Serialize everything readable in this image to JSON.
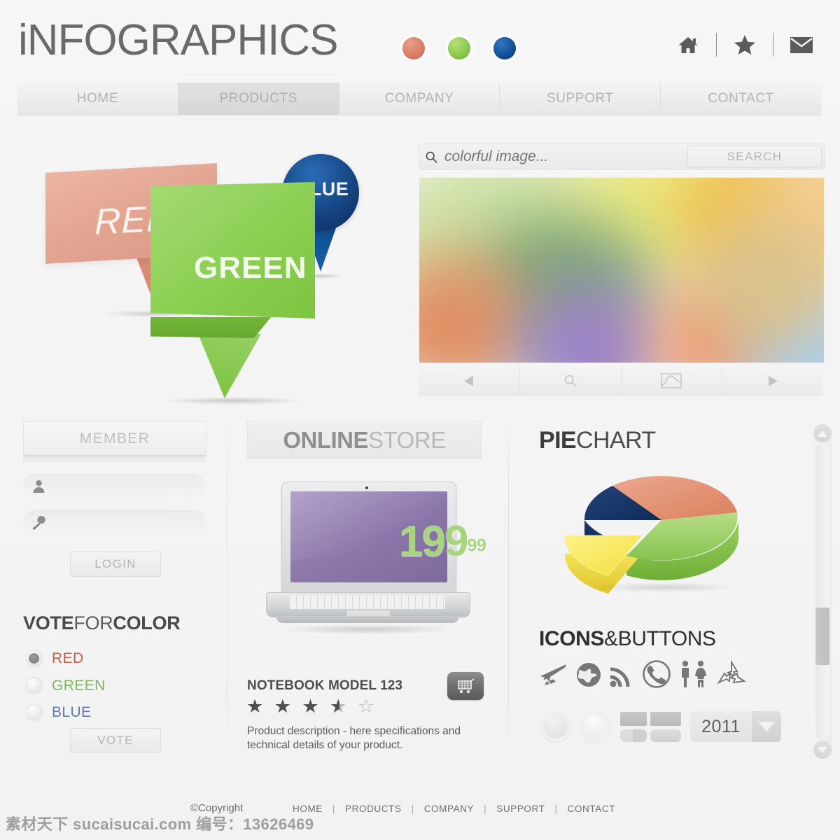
{
  "header": {
    "logo_prefix": "i",
    "logo_text": "NFOGRAPHICS",
    "dots": [
      {
        "name": "red-dot",
        "color": "#d4775c"
      },
      {
        "name": "green-dot",
        "color": "#7ec242"
      },
      {
        "name": "blue-dot",
        "color": "#104a8e"
      }
    ],
    "icons": [
      {
        "name": "home-icon",
        "glyph": "home"
      },
      {
        "name": "star-icon",
        "glyph": "star"
      },
      {
        "name": "mail-icon",
        "glyph": "envelope"
      }
    ]
  },
  "nav": {
    "items": [
      {
        "label": "HOME",
        "active": false
      },
      {
        "label": "PRODUCTS",
        "active": true
      },
      {
        "label": "COMPANY",
        "active": false
      },
      {
        "label": "SUPPORT",
        "active": false
      },
      {
        "label": "CONTACT",
        "active": false
      }
    ]
  },
  "hero": {
    "ribbons": [
      {
        "label": "RED",
        "color": "#e2a390"
      },
      {
        "label": "GREEN",
        "color": "#8ccf52"
      },
      {
        "label": "BLUE",
        "color": "#15437f"
      }
    ]
  },
  "search": {
    "placeholder": "colorful image...",
    "value": "",
    "button_label": "SEARCH",
    "icon": "search-icon"
  },
  "slider": {
    "controls": [
      {
        "name": "prev-button",
        "glyph": "triangle-left"
      },
      {
        "name": "zoom-button",
        "glyph": "magnifier"
      },
      {
        "name": "gallery-button",
        "glyph": "image"
      },
      {
        "name": "next-button",
        "glyph": "triangle-right"
      }
    ]
  },
  "member": {
    "title": "MEMBER",
    "username": {
      "value": "",
      "placeholder": "",
      "icon": "user-icon"
    },
    "password": {
      "value": "",
      "placeholder": "",
      "icon": "key-icon"
    },
    "login_label": "LOGIN"
  },
  "vote": {
    "title_bold_1": "VOTE",
    "title_regular": "FOR",
    "title_bold_2": "COLOR",
    "options": [
      {
        "label": "RED",
        "color": "#c0604a",
        "selected": true
      },
      {
        "label": "GREEN",
        "color": "#7fb75a",
        "selected": false
      },
      {
        "label": "BLUE",
        "color": "#5a7fa8",
        "selected": false
      }
    ],
    "button_label": "VOTE"
  },
  "store": {
    "title_bold": "ONLINE",
    "title_regular": "STORE",
    "price_main": "199",
    "price_cents": "99",
    "product_name": "NOTEBOOK MODEL 123",
    "rating": 3.5,
    "rating_max": 5,
    "description": "Product description - here specifications and technical details of your product.",
    "cart_icon": "shopping-cart-icon"
  },
  "piechart": {
    "title_bold": "PIE",
    "title_regular": "CHART",
    "chart_data": {
      "type": "pie",
      "title": "PIECHART",
      "labels": [
        "Green",
        "Red",
        "Blue",
        "Yellow"
      ],
      "values": [
        40,
        20,
        20,
        20
      ],
      "colors": [
        "#8cc85a",
        "#e19077",
        "#163a6e",
        "#f5e04f"
      ],
      "exploded": [
        "Yellow"
      ],
      "legend": "none",
      "three_d": true
    }
  },
  "icons_section": {
    "title_bold": "ICONS",
    "title_amp": "&",
    "title_regular": "BUTTONS",
    "icons": [
      {
        "name": "airplane-icon"
      },
      {
        "name": "globe-icon"
      },
      {
        "name": "wifi-icon"
      },
      {
        "name": "phone-icon"
      },
      {
        "name": "restroom-icon"
      },
      {
        "name": "recycle-icon"
      }
    ],
    "buttons": [
      {
        "name": "circle-button-1"
      },
      {
        "name": "circle-button-2"
      },
      {
        "name": "grid-button-group"
      }
    ],
    "year_select": {
      "value": "2011",
      "name": "year-dropdown"
    }
  },
  "scrollbar": {
    "up": "scroll-up-arrow",
    "down": "scroll-down-arrow",
    "thumb": "scroll-thumb"
  },
  "footer": {
    "copyright": "©Copyright",
    "links": [
      "HOME",
      "PRODUCTS",
      "COMPANY",
      "SUPPORT",
      "CONTACT"
    ],
    "separator": "|"
  },
  "watermark": "素材天下 sucaisucai.com  编号：13626469"
}
